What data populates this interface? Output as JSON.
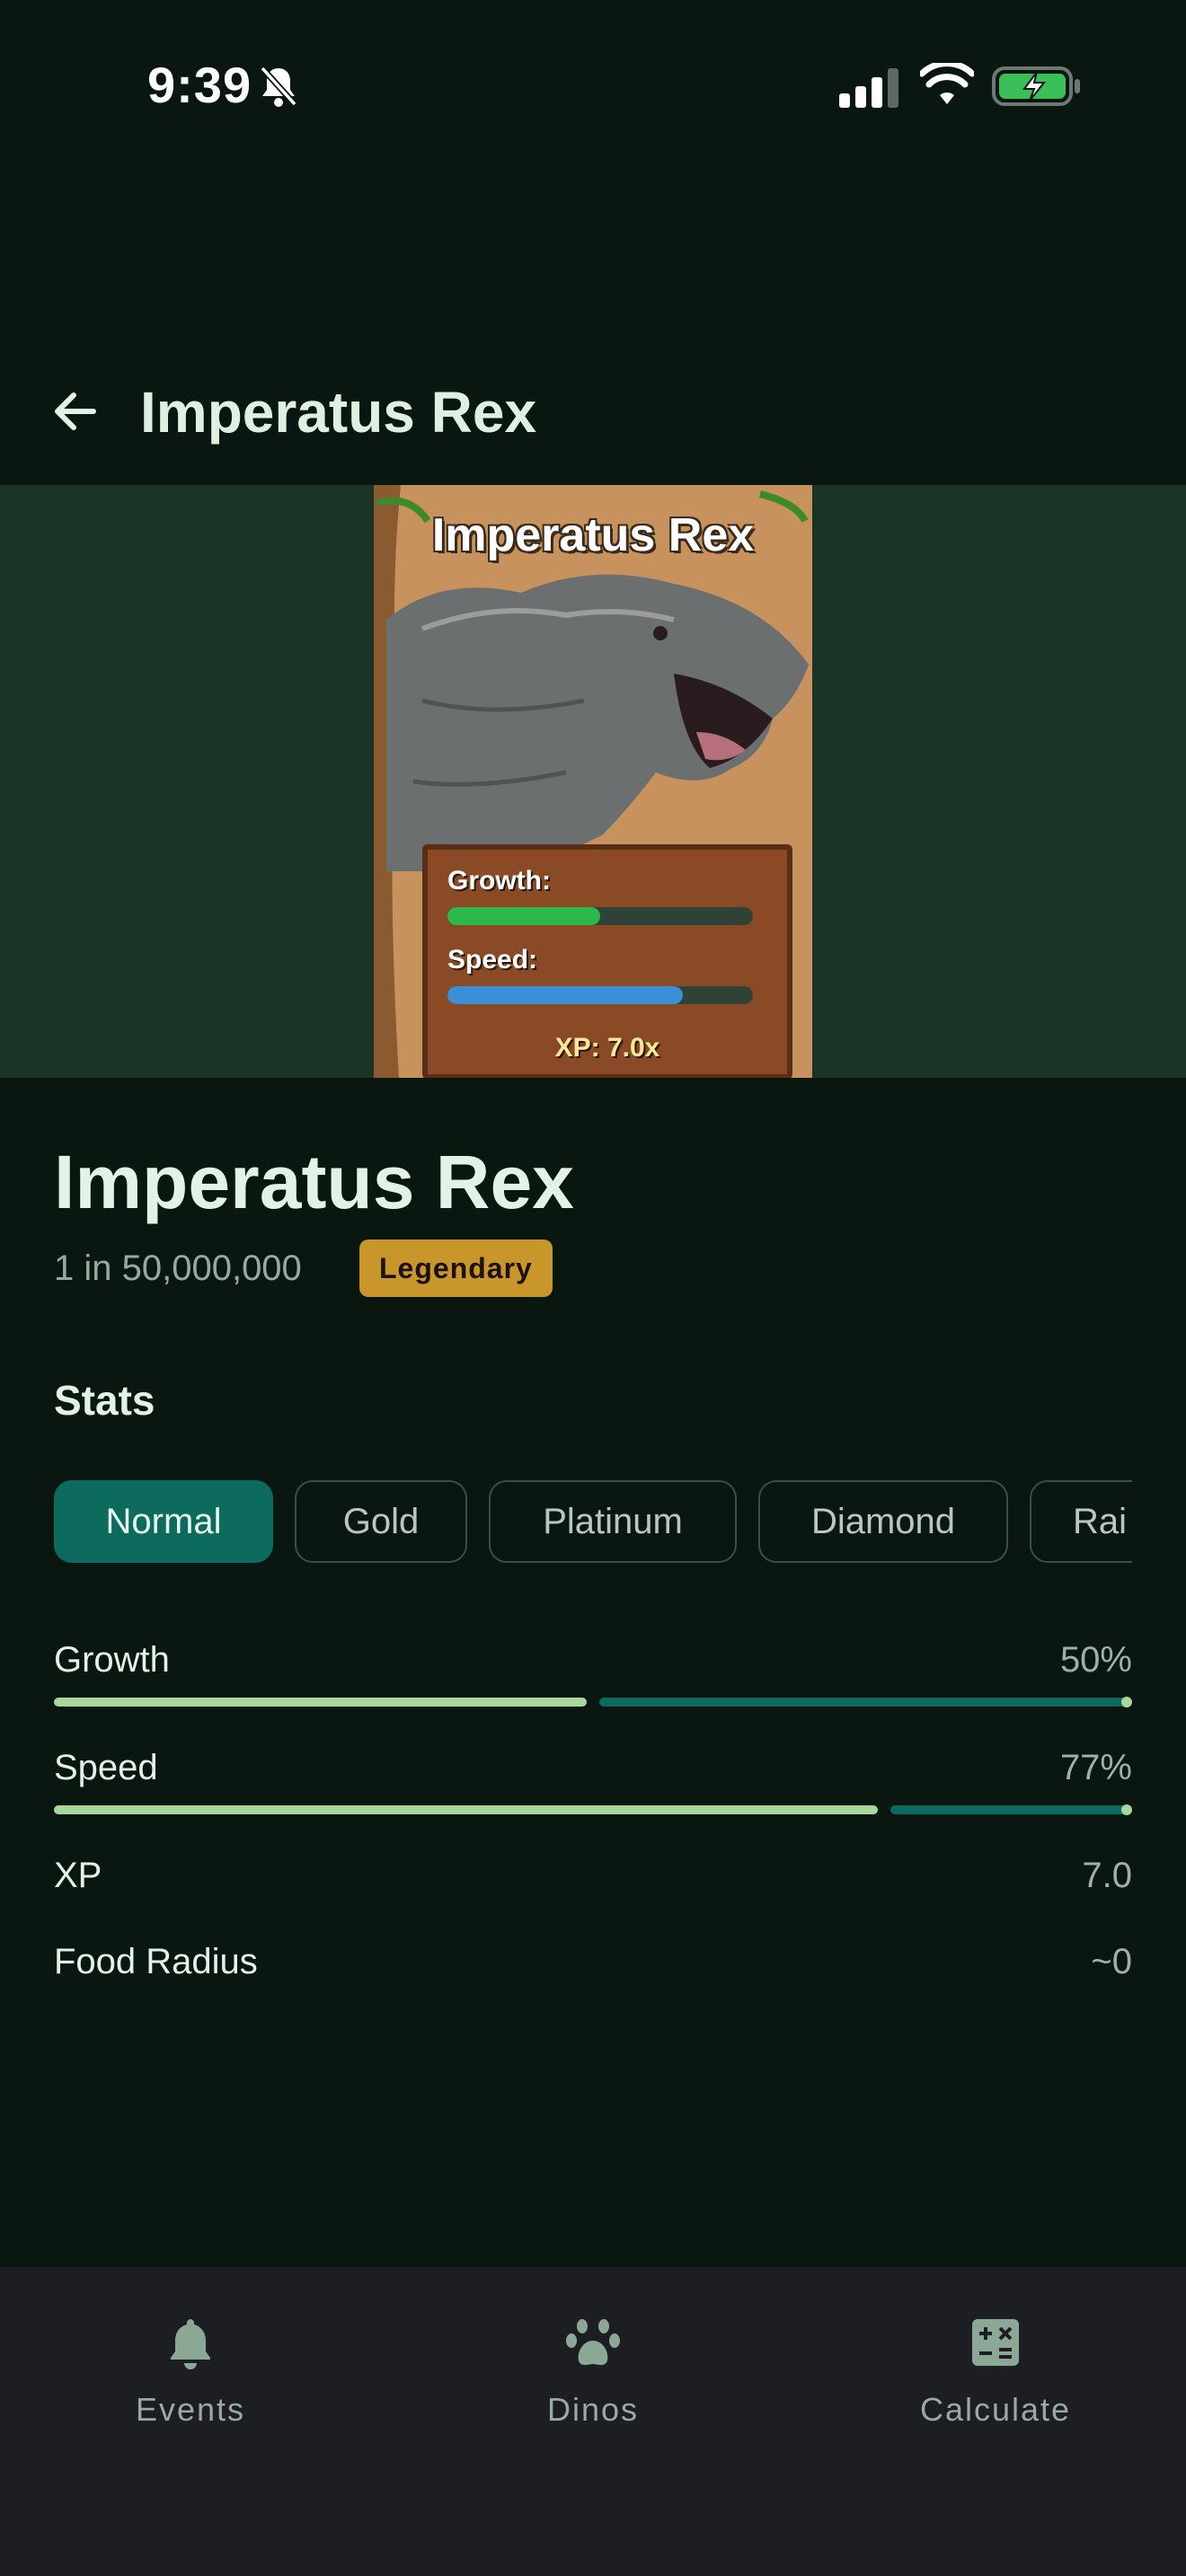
{
  "status": {
    "time": "9:39",
    "icons": [
      "bell-off-icon",
      "signal-icon",
      "wifi-icon",
      "battery-charging-icon"
    ]
  },
  "header": {
    "title": "Imperatus Rex"
  },
  "hero_card": {
    "title": "Imperatus Rex",
    "growth_label": "Growth:",
    "speed_label": "Speed:",
    "xp_label": "XP: 7.0x",
    "growth_fraction": 0.5,
    "speed_fraction": 0.77,
    "colors": {
      "growth": "#2db84a",
      "speed": "#3a8fd8"
    }
  },
  "detail": {
    "name": "Imperatus Rex",
    "rarity_odds": "1 in 50,000,000",
    "rarity_badge": "Legendary",
    "stats_heading": "Stats",
    "variants": [
      {
        "label": "Normal",
        "selected": true
      },
      {
        "label": "Gold",
        "selected": false
      },
      {
        "label": "Platinum",
        "selected": false
      },
      {
        "label": "Diamond",
        "selected": false
      },
      {
        "label": "Rai",
        "selected": false
      }
    ],
    "stats": {
      "growth": {
        "label": "Growth",
        "value": "50%",
        "fraction": 0.5
      },
      "speed": {
        "label": "Speed",
        "value": "77%",
        "fraction": 0.77
      },
      "xp": {
        "label": "XP",
        "value": "7.0"
      },
      "food_radius": {
        "label": "Food Radius",
        "value": "~0"
      }
    }
  },
  "nav": {
    "items": [
      {
        "label": "Events",
        "icon": "bell-icon"
      },
      {
        "label": "Dinos",
        "icon": "paw-icon"
      },
      {
        "label": "Calculate",
        "icon": "calculator-icon"
      }
    ]
  },
  "colors": {
    "background": "#0a1711",
    "accent": "#0c6b5c",
    "bar_light": "#a8d8a0",
    "badge": "#c9962c",
    "nav_bg": "#1d1d24"
  }
}
